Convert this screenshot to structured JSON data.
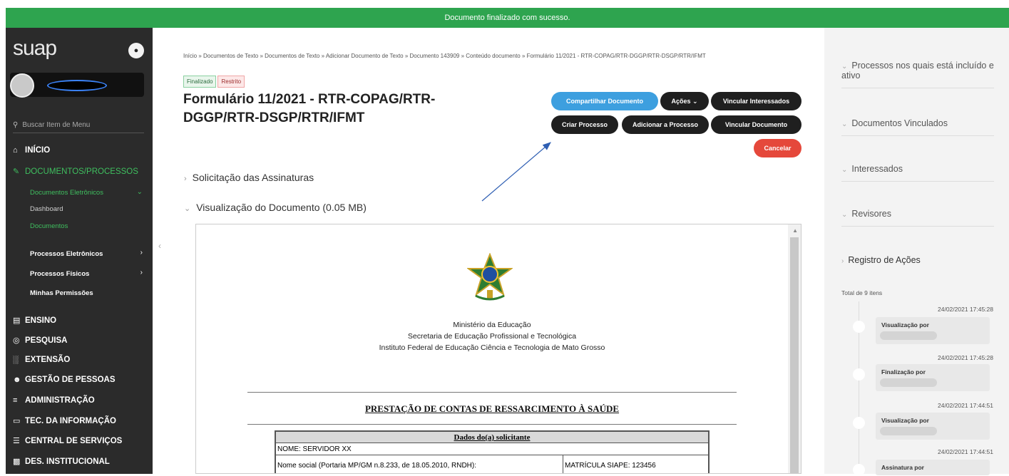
{
  "banner": {
    "text": "Documento finalizado com sucesso."
  },
  "sidebar": {
    "logo": "suap",
    "search_placeholder": "Buscar Item de Menu",
    "items": [
      {
        "label": "INÍCIO",
        "icon": "home-icon"
      },
      {
        "label": "DOCUMENTOS/PROCESSOS",
        "icon": "document-edit-icon"
      },
      {
        "label": "ENSINO",
        "icon": "chalkboard-icon"
      },
      {
        "label": "PESQUISA",
        "icon": "globe-icon"
      },
      {
        "label": "EXTENSÃO",
        "icon": "building-icon"
      },
      {
        "label": "GESTÃO DE PESSOAS",
        "icon": "users-icon"
      },
      {
        "label": "ADMINISTRAÇÃO",
        "icon": "list-icon"
      },
      {
        "label": "TEC. DA INFORMAÇÃO",
        "icon": "laptop-icon"
      },
      {
        "label": "CENTRAL DE SERVIÇOS",
        "icon": "menu-icon"
      },
      {
        "label": "DES. INSTITUCIONAL",
        "icon": "chart-icon"
      }
    ],
    "subitems": [
      {
        "label": "Documentos Eletrônicos"
      },
      {
        "label": "Dashboard"
      },
      {
        "label": "Documentos"
      },
      {
        "label": "Processos Eletrônicos"
      },
      {
        "label": "Processos Físicos"
      },
      {
        "label": "Minhas Permissões"
      }
    ]
  },
  "breadcrumb": "Início » Documentos de Texto » Documentos de Texto » Adicionar Documento de Texto » Documento 143909 » Conteúdo documento » Formulário 11/2021 - RTR-COPAG/RTR-DGGP/RTR-DSGP/RTR/IFMT",
  "tags": {
    "finalizado": "Finalizado",
    "restrito": "Restrito"
  },
  "title": "Formulário 11/2021 - RTR-COPAG/RTR-DGGP/RTR-DSGP/RTR/IFMT",
  "actions": {
    "compartilhar": "Compartilhar Documento",
    "acoes": "Ações",
    "vincular_interessados": "Vincular Interessados",
    "criar_processo": "Criar Processo",
    "adicionar_processo": "Adicionar a Processo",
    "vincular_documento": "Vincular Documento",
    "cancelar": "Cancelar"
  },
  "sections": {
    "assinaturas": "Solicitação das Assinaturas",
    "visualizacao": "Visualização do Documento (0.05 MB)"
  },
  "document": {
    "org_lines": [
      "Ministério da Educação",
      "Secretaria de Educação Profissional e Tecnológica",
      "Instituto Federal de Educação Ciência e Tecnologia de Mato Grosso"
    ],
    "heading": "PRESTAÇÃO DE CONTAS DE RESSARCIMENTO À SAÚDE",
    "table_header": "Dados do(a) solicitante",
    "nome": "NOME: SERVIDOR XX",
    "nome_social": "Nome social (Portaria MP/GM n.8.233, de 18.05.2010, RNDH):",
    "matricula": "MATRÍCULA SIAPE: 123456"
  },
  "right_panel": {
    "sections": [
      "Processos nos quais está incluído e ativo",
      "Documentos Vinculados",
      "Interessados",
      "Revisores",
      "Registro de Ações"
    ],
    "total": "Total de 9 itens",
    "log": [
      {
        "date": "24/02/2021 17:45:28",
        "action": "Visualização por"
      },
      {
        "date": "24/02/2021 17:45:28",
        "action": "Finalização por"
      },
      {
        "date": "24/02/2021 17:44:51",
        "action": "Visualização por"
      },
      {
        "date": "24/02/2021 17:44:51",
        "action": "Assinatura por"
      }
    ]
  },
  "colors": {
    "banner": "#2ea44f",
    "sidebar": "#2b2b2b",
    "accent_green": "#3fbf5f",
    "primary": "#3d9fdf",
    "danger": "#e5483b"
  }
}
